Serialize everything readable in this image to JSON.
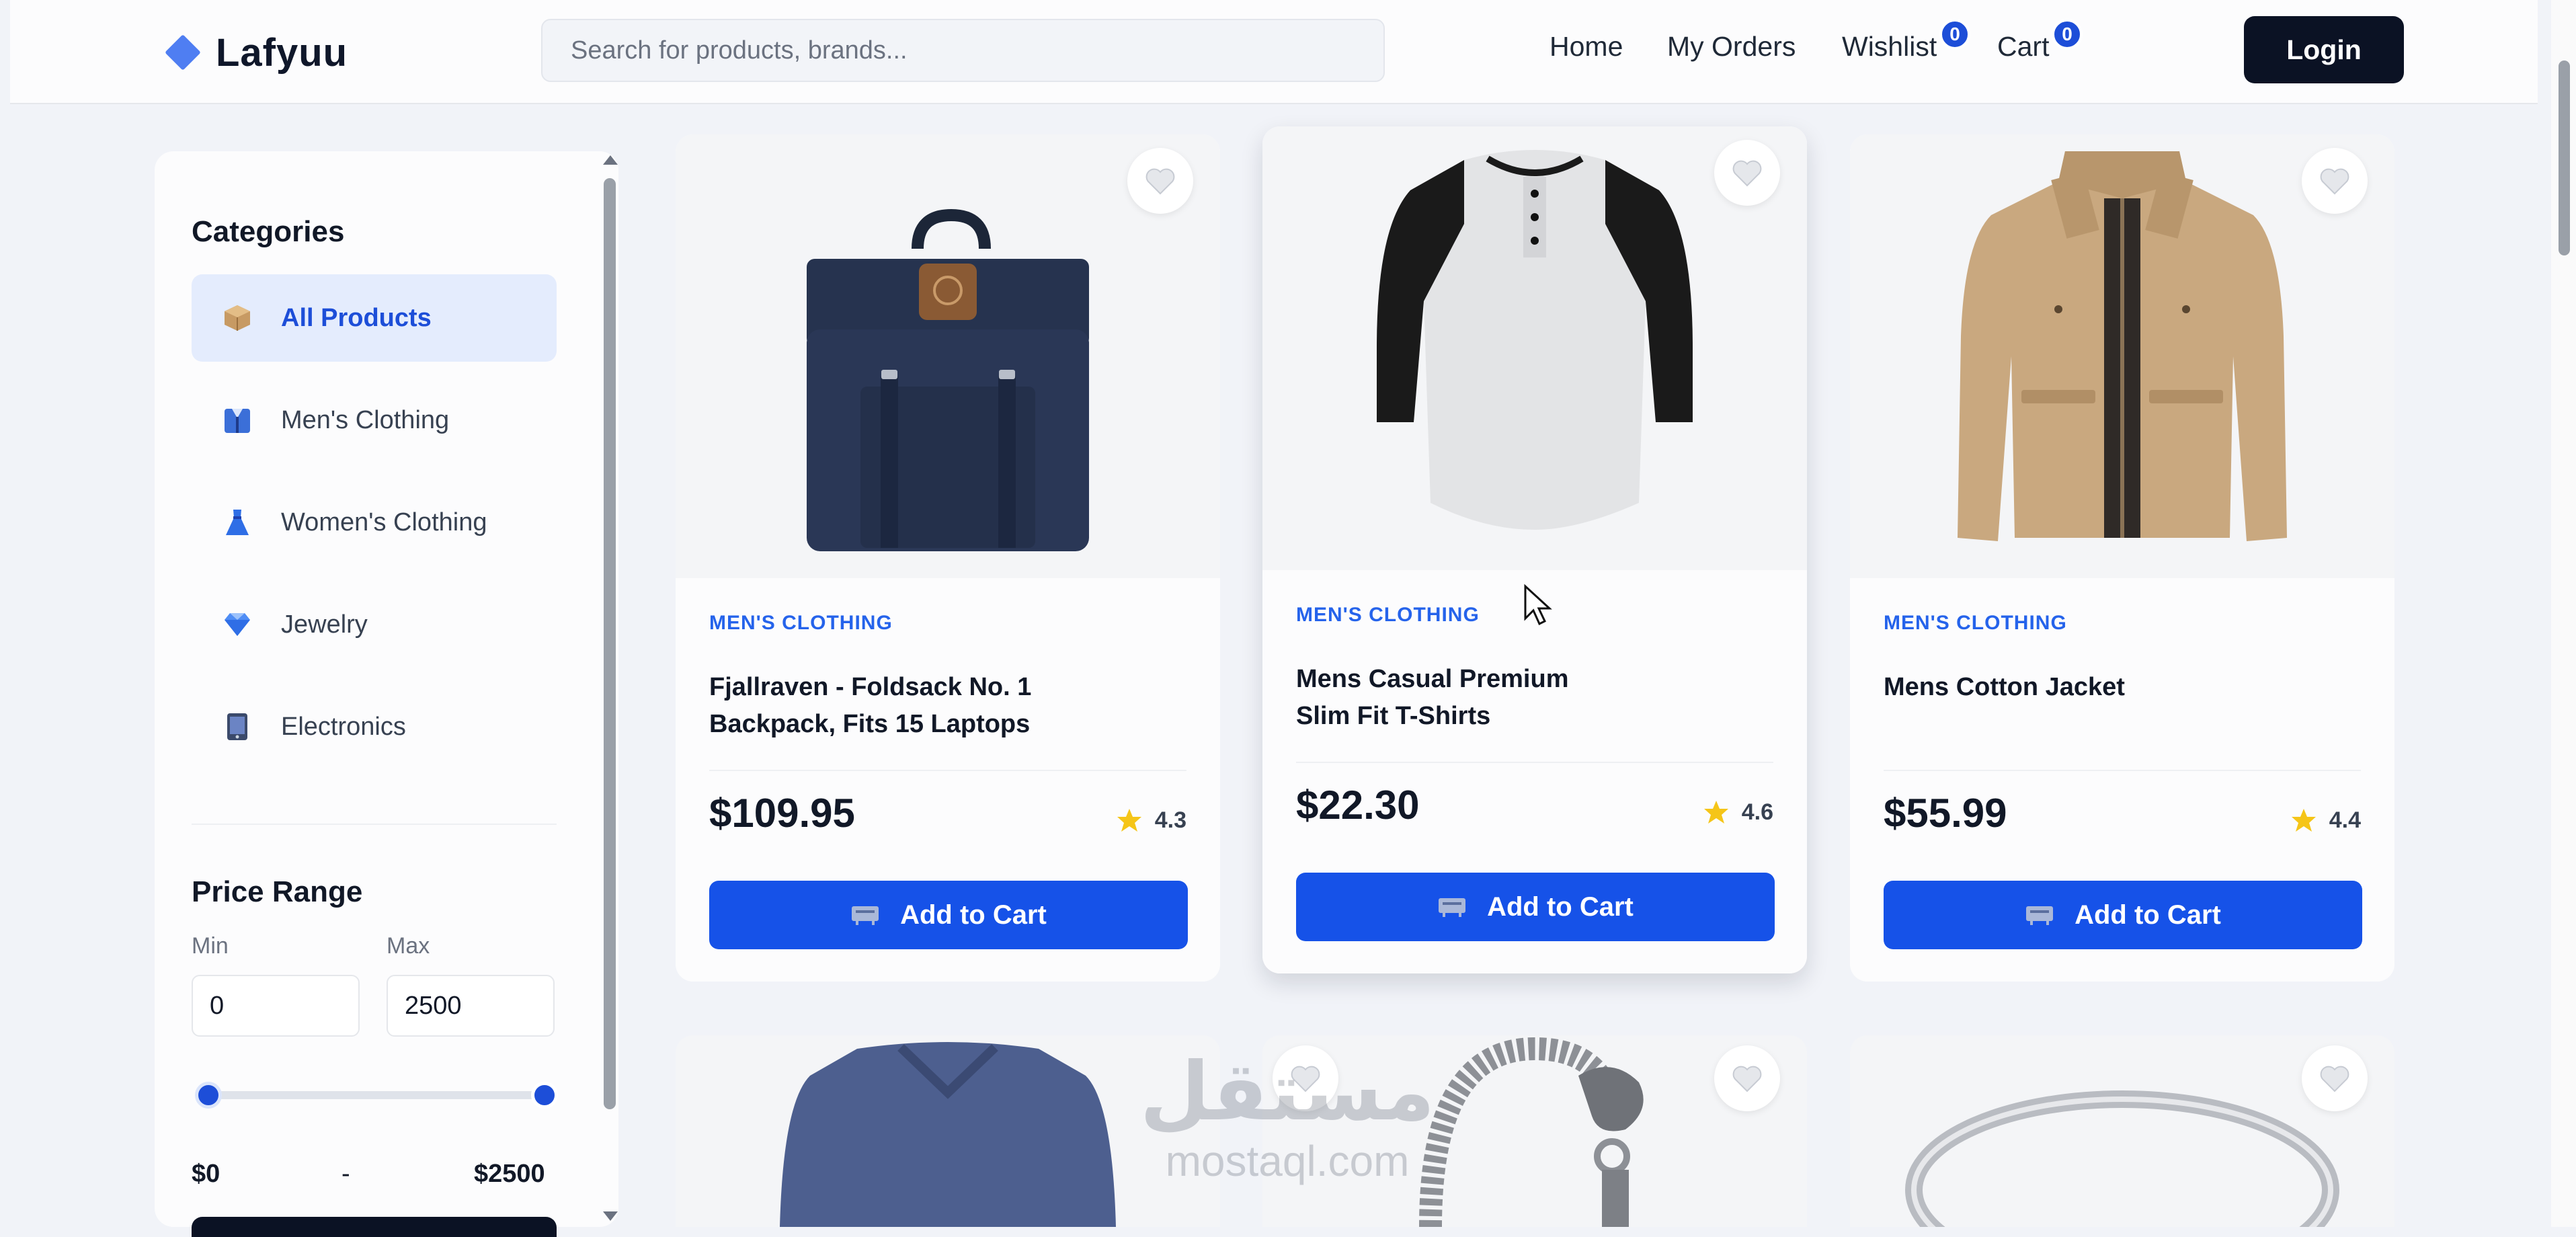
{
  "header": {
    "brand": "Lafyuu",
    "search_placeholder": "Search for products, brands...",
    "nav": {
      "home": "Home",
      "orders": "My Orders",
      "wishlist": "Wishlist",
      "wishlist_count": "0",
      "cart": "Cart",
      "cart_count": "0"
    },
    "login_label": "Login"
  },
  "sidebar": {
    "categories_title": "Categories",
    "categories": [
      {
        "label": "All Products",
        "icon": "box-icon",
        "active": true
      },
      {
        "label": "Men's Clothing",
        "icon": "shirt-icon",
        "active": false
      },
      {
        "label": "Women's Clothing",
        "icon": "dress-icon",
        "active": false
      },
      {
        "label": "Jewelry",
        "icon": "diamond-icon",
        "active": false
      },
      {
        "label": "Electronics",
        "icon": "device-icon",
        "active": false
      }
    ],
    "price": {
      "title": "Price Range",
      "min_label": "Min",
      "max_label": "Max",
      "min_value": "0",
      "max_value": "2500",
      "min_display": "$0",
      "separator": "-",
      "max_display": "$2500"
    }
  },
  "products": [
    {
      "category": "MEN'S CLOTHING",
      "title": "Fjallraven - Foldsack No. 1 Backpack, Fits 15 Laptops",
      "price": "$109.95",
      "rating": "4.3",
      "button": "Add to Cart",
      "image": "backpack-image"
    },
    {
      "category": "MEN'S CLOTHING",
      "title": "Mens Casual Premium Slim Fit T-Shirts",
      "price": "$22.30",
      "rating": "4.6",
      "button": "Add to Cart",
      "image": "raglan-tshirt-image"
    },
    {
      "category": "MEN'S CLOTHING",
      "title": "Mens Cotton Jacket",
      "price": "$55.99",
      "rating": "4.4",
      "button": "Add to Cart",
      "image": "jacket-image"
    }
  ],
  "second_row_images": [
    "sweater-image",
    "bracelet-image",
    "ring-image"
  ],
  "watermark": {
    "arabic": "مستقل",
    "latin": "mostaql.com"
  },
  "colors": {
    "accent": "#1652e8",
    "dark": "#0b1224",
    "star": "#f5c518",
    "category_text": "#2563eb"
  }
}
